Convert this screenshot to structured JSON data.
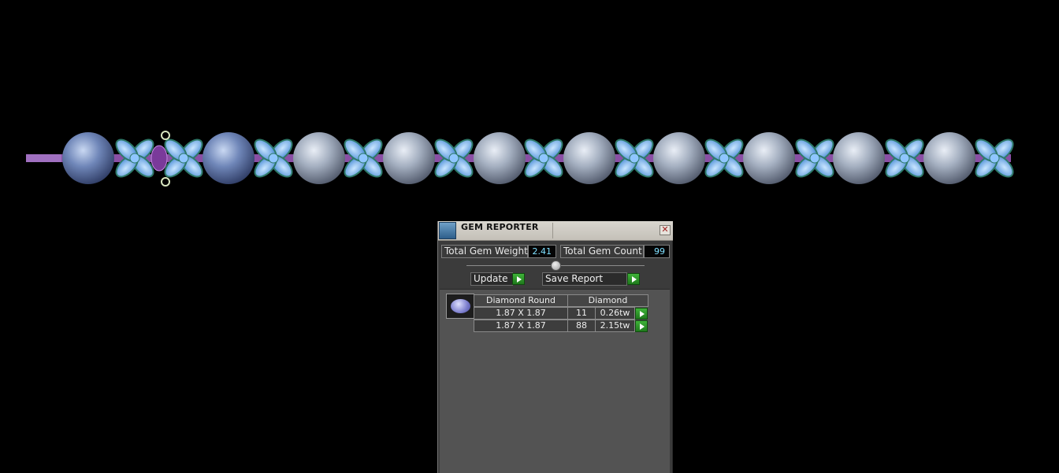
{
  "panel": {
    "title": "GEM REPORTER",
    "close_symbol": "✕",
    "total_weight_label": "Total Gem Weight",
    "total_weight_value": "2.41",
    "total_count_label": "Total Gem Count",
    "total_count_value": "99",
    "update_label": "Update",
    "save_report_label": "Save Report"
  },
  "gems": {
    "group_headers": [
      "Diamond Round",
      "Diamond"
    ],
    "rows": [
      {
        "size": "1.87 X 1.87",
        "count": "11",
        "weight": "0.26tw"
      },
      {
        "size": "1.87 X 1.87",
        "count": "88",
        "weight": "2.15tw"
      }
    ]
  },
  "colors": {
    "background": "#000000",
    "accent_green": "#2fa52a",
    "value_cyan": "#7fe0ff",
    "gem_blue": "#7aa8e8",
    "pearl_gray": "#9aa8b8",
    "chain_purple": "#9a5fb0"
  },
  "icons": {
    "title_logo": "gem-reporter-logo-icon",
    "close": "close-icon",
    "slider": "slider-knob-icon",
    "arrow": "play-arrow-icon",
    "gem_thumbnail": "round-gem-icon"
  }
}
